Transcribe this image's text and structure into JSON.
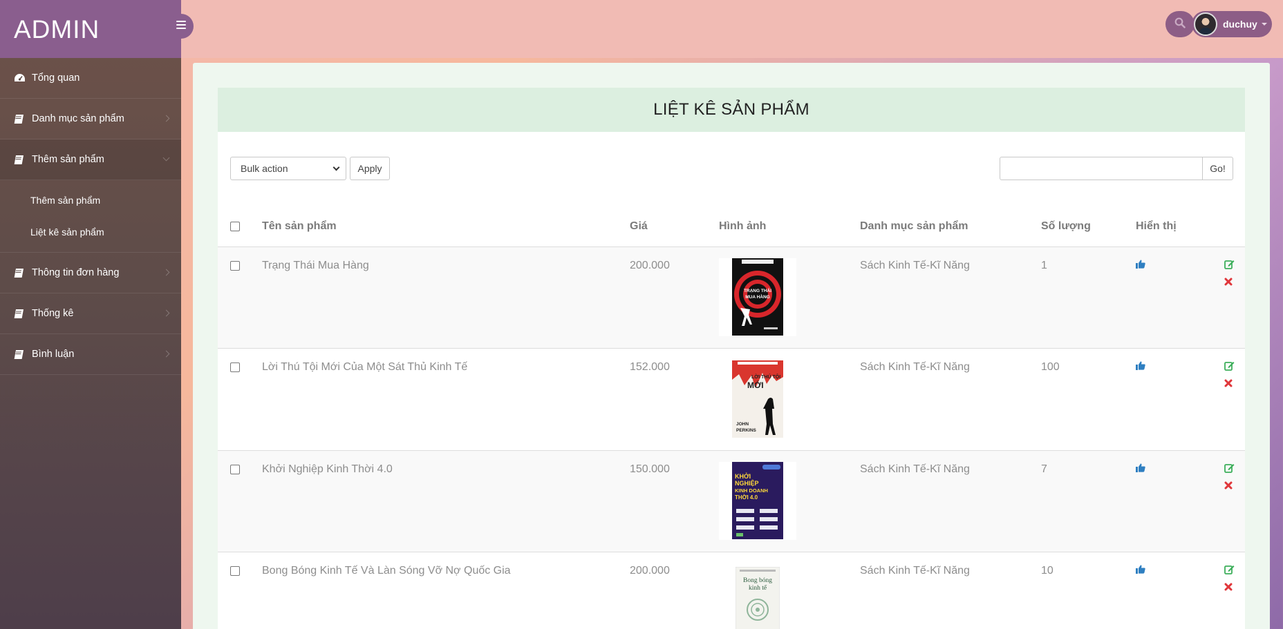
{
  "sidebar": {
    "brand": "ADMIN",
    "items": [
      {
        "label": "Tổng quan",
        "icon": "dashboard-icon"
      },
      {
        "label": "Danh mục sản phẩm",
        "icon": "book-icon"
      },
      {
        "label": "Thêm sản phẩm",
        "icon": "book-icon",
        "open": true,
        "sub": [
          "Thêm sản phẩm",
          "Liệt kê sản phẩm"
        ]
      },
      {
        "label": "Thông tin đơn hàng",
        "icon": "book-icon"
      },
      {
        "label": "Thống kê",
        "icon": "book-icon"
      },
      {
        "label": "Bình luận",
        "icon": "book-icon"
      }
    ]
  },
  "header": {
    "username": "duchuy"
  },
  "main": {
    "title": "LIỆT KÊ SẢN PHẨM",
    "bulk_action": "Bulk action",
    "apply_label": "Apply",
    "search_placeholder": "",
    "go_label": "Go!",
    "columns": [
      "Tên sản phẩm",
      "Giá",
      "Hình ảnh",
      "Danh mục sản phẩm",
      "Số lượng",
      "Hiển thị"
    ],
    "rows": [
      {
        "name": "Trạng Thái Mua Hàng",
        "price": "200.000",
        "category": "Sách Kinh Tế-Kĩ Năng",
        "qty": "1",
        "cover_text": "TRẠNG THÁI MUA HÀNG"
      },
      {
        "name": "Lời Thú Tội Mới Của Một Sát Thủ Kinh Tế",
        "price": "152.000",
        "category": "Sách Kinh Tế-Kĩ Năng",
        "qty": "100",
        "cover_text": "JOHN PERKINS"
      },
      {
        "name": "Khởi Nghiệp Kinh Thời 4.0",
        "price": "150.000",
        "category": "Sách Kinh Tế-Kĩ Năng",
        "qty": "7",
        "cover_text": "KHỞI NGHIỆP KINH DOANH THỜI 4.0"
      },
      {
        "name": "Bong Bóng Kinh Tế Và Làn Sóng Vỡ Nợ Quốc Gia",
        "price": "200.000",
        "category": "Sách Kinh Tế-Kĩ Năng",
        "qty": "10",
        "cover_text": "Bong bóng kinh tế"
      }
    ]
  },
  "colors": {
    "brand": "#8a5e8e",
    "header": "#f1bbb4",
    "title_bg": "#dcefe0",
    "like": "#2f7fc1",
    "edit": "#3cae5a",
    "delete": "#e0363a"
  }
}
